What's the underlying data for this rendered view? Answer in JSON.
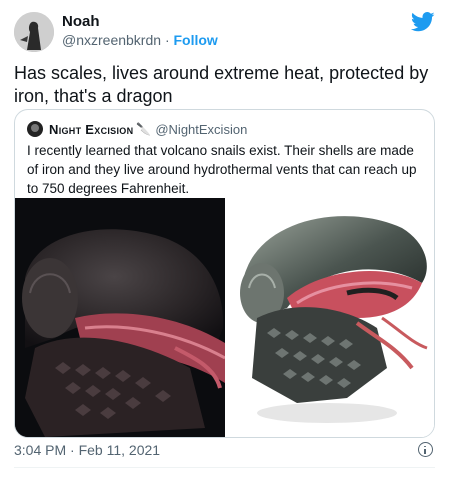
{
  "author": {
    "name": "Noah",
    "handle": "@nxzreenbkrdn",
    "separator": "·",
    "follow_label": "Follow"
  },
  "tweet": {
    "text": "Has scales, lives around extreme heat, protected by iron, that's a dragon",
    "timestamp": "3:04 PM · Feb 11, 2021"
  },
  "quoted_tweet": {
    "name": "Night Excision",
    "emoji": "🔪",
    "handle": "@NightExcision",
    "text": "I recently learned that volcano snails exist. Their shells are made of iron and they live around hydrothermal vents that can reach up to 750 degrees Fahrenheit."
  },
  "icons": {
    "brand": "twitter-bird-icon",
    "info": "info-icon"
  },
  "colors": {
    "brand_blue": "#1d9bf0",
    "text": "#0f1419",
    "secondary": "#536471",
    "border": "#cfd9de"
  }
}
